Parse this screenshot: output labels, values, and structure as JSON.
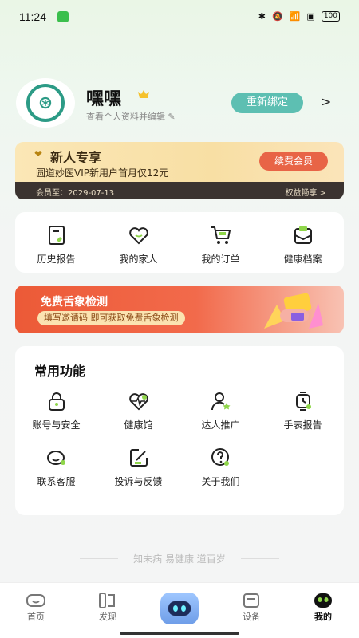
{
  "status": {
    "time": "11:24",
    "battery": "100"
  },
  "profile": {
    "name": "嘿嘿",
    "edit_label": "查看个人资料并编辑",
    "rebind_label": "重新绑定"
  },
  "vip": {
    "title": "新人专享",
    "desc": "圆道妙医VIP新用户首月仅12元",
    "renew_label": "续费会员",
    "expire": "会员至：2029-07-13",
    "rights_label": "权益畅享 >"
  },
  "quick": [
    {
      "label": "历史报告",
      "icon": "report-icon"
    },
    {
      "label": "我的家人",
      "icon": "heart-icon"
    },
    {
      "label": "我的订单",
      "icon": "cart-icon"
    },
    {
      "label": "健康档案",
      "icon": "archive-icon"
    }
  ],
  "banner": {
    "title": "免费舌象检测",
    "subtitle": "填写邀请码 即可获取免费舌象检测"
  },
  "functions": {
    "title": "常用功能",
    "items": [
      {
        "label": "账号与安全",
        "icon": "lock-icon"
      },
      {
        "label": "健康馆",
        "icon": "health-heart-icon"
      },
      {
        "label": "达人推广",
        "icon": "promoter-icon"
      },
      {
        "label": "手表报告",
        "icon": "watch-icon"
      },
      {
        "label": "联系客服",
        "icon": "service-icon"
      },
      {
        "label": "投诉与反馈",
        "icon": "feedback-icon"
      },
      {
        "label": "关于我们",
        "icon": "question-icon"
      }
    ]
  },
  "slogan": "知未病 易健康 道百岁",
  "tabs": [
    {
      "label": "首页",
      "icon": "home-icon"
    },
    {
      "label": "发现",
      "icon": "discover-icon"
    },
    {
      "label": "",
      "icon": "robot-icon"
    },
    {
      "label": "设备",
      "icon": "device-icon"
    },
    {
      "label": "我的",
      "icon": "profile-icon"
    }
  ],
  "colors": {
    "accent": "#5dbfb2",
    "renew": "#e86446",
    "banner": "#ec5a37",
    "icon_accent": "#8fd64a"
  }
}
